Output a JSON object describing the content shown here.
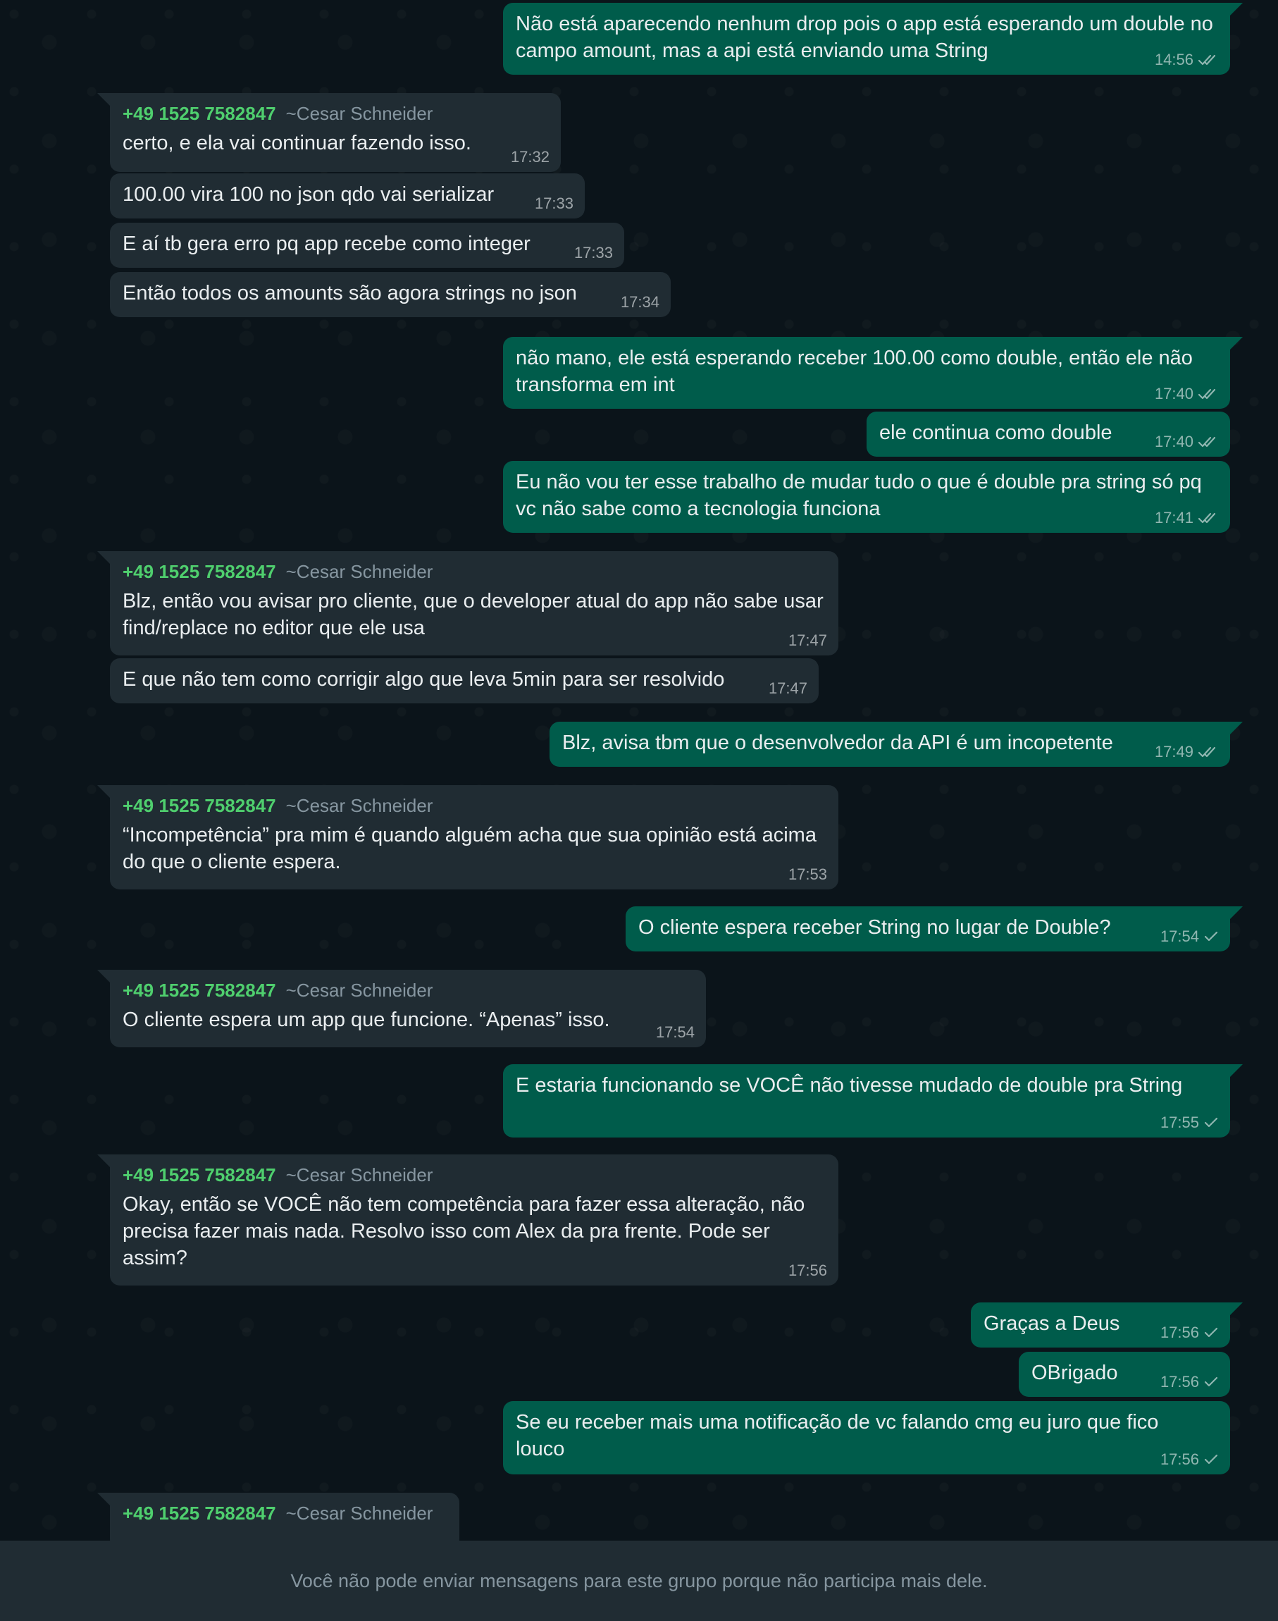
{
  "sender": {
    "phone": "+49 1525 7582847",
    "name": "~Cesar Schneider"
  },
  "messages": [
    {
      "dir": "out",
      "lines": [
        "Não está aparecendo nenhum drop pois o app está esperando um double no",
        "campo amount, mas a api está enviando uma String"
      ],
      "time": "14:56",
      "status": "read"
    },
    {
      "dir": "in",
      "showSender": true,
      "lines": [
        "certo, e ela vai continuar fazendo isso."
      ],
      "time": "17:32"
    },
    {
      "dir": "in",
      "lines": [
        "100.00 vira 100 no json qdo vai serializar"
      ],
      "time": "17:33"
    },
    {
      "dir": "in",
      "lines": [
        "E aí tb gera erro pq app recebe como integer"
      ],
      "time": "17:33"
    },
    {
      "dir": "in",
      "lines": [
        "Então todos os amounts são agora strings no json"
      ],
      "time": "17:34"
    },
    {
      "dir": "out",
      "lines": [
        "não mano, ele está esperando receber 100.00 como double, então ele não",
        "transforma em int"
      ],
      "time": "17:40",
      "status": "read"
    },
    {
      "dir": "out",
      "lines": [
        "ele continua como double"
      ],
      "time": "17:40",
      "status": "read"
    },
    {
      "dir": "out",
      "lines": [
        "Eu não vou ter esse trabalho de mudar tudo o que é double pra string só pq",
        "vc não sabe como a tecnologia funciona"
      ],
      "time": "17:41",
      "status": "read"
    },
    {
      "dir": "in",
      "showSender": true,
      "lines": [
        "Blz, então vou avisar pro cliente, que o developer atual do app não sabe usar",
        "find/replace no editor que ele usa"
      ],
      "time": "17:47"
    },
    {
      "dir": "in",
      "lines": [
        "E que não tem como corrigir algo que leva 5min para ser resolvido"
      ],
      "time": "17:47"
    },
    {
      "dir": "out",
      "lines": [
        "Blz, avisa tbm que o desenvolvedor da API é um incopetente"
      ],
      "time": "17:49",
      "status": "read"
    },
    {
      "dir": "in",
      "showSender": true,
      "lines": [
        "“Incompetência” pra mim é quando alguém acha que sua opinião está acima",
        "do que o cliente espera."
      ],
      "time": "17:53"
    },
    {
      "dir": "out",
      "lines": [
        "O cliente espera receber String no lugar de Double?"
      ],
      "time": "17:54",
      "status": "sent"
    },
    {
      "dir": "in",
      "showSender": true,
      "lines": [
        "O cliente espera um app que funcione. “Apenas” isso."
      ],
      "time": "17:54"
    },
    {
      "dir": "out",
      "lines": [
        "E estaria funcionando se VOCÊ não tivesse mudado de double pra String"
      ],
      "time": "17:55",
      "status": "sent"
    },
    {
      "dir": "in",
      "showSender": true,
      "lines": [
        "Okay, então se VOCÊ não tem competência para fazer essa alteração, não",
        "precisa fazer mais nada. Resolvo isso com Alex da pra frente. Pode ser",
        "assim?"
      ],
      "time": "17:56"
    },
    {
      "dir": "out",
      "lines": [
        "Graças a Deus"
      ],
      "time": "17:56",
      "status": "sent"
    },
    {
      "dir": "out",
      "lines": [
        "OBrigado"
      ],
      "time": "17:56",
      "status": "sent"
    },
    {
      "dir": "out",
      "lines": [
        "Se eu receber mais uma notificação de vc falando cmg eu juro que fico",
        "louco"
      ],
      "time": "17:56",
      "status": "sent"
    },
    {
      "dir": "in",
      "showSender": true,
      "lines": [],
      "time": ""
    }
  ],
  "footer": {
    "notice": "Você não pode enviar mensagens para este grupo porque não participa mais dele."
  },
  "colors": {
    "incoming": "#202c33",
    "outgoing": "#005c4b",
    "sender_phone": "#4fcf6e",
    "background": "#0b141a"
  }
}
